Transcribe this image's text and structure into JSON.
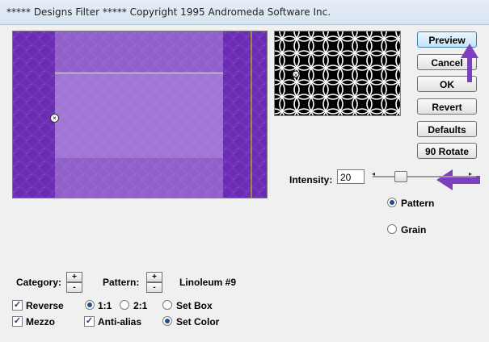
{
  "window": {
    "title": "***** Designs Filter *****  Copyright 1995 Andromeda Software Inc."
  },
  "buttons": {
    "preview": "Preview",
    "cancel": "Cancel",
    "ok": "OK",
    "revert": "Revert",
    "defaults": "Defaults",
    "rotate": "90 Rotate"
  },
  "intensity": {
    "label": "Intensity:",
    "value": "20",
    "slider_fraction": 0.2
  },
  "mode": {
    "pattern_label": "Pattern",
    "grain_label": "Grain",
    "selected": "pattern"
  },
  "category": {
    "label": "Category:",
    "plus": "+",
    "minus": "-"
  },
  "pattern_selector": {
    "label": "Pattern:",
    "plus": "+",
    "minus": "-",
    "current": "Linoleum #9"
  },
  "options": {
    "reverse_label": "Reverse",
    "reverse_checked": true,
    "mezzo_label": "Mezzo",
    "mezzo_checked": true,
    "scale_1_1": "1:1",
    "scale_2_1": "2:1",
    "scale_selected": "1:1",
    "antialias_label": "Anti-alias",
    "antialias_checked": true,
    "set_box_label": "Set Box",
    "set_color_label": "Set Color",
    "set_selected": "set-color"
  },
  "colors": {
    "preview_purple": "#6b2bb5",
    "annotation_arrow": "#7b3fbf",
    "primary_button_border": "#3c7fb1"
  }
}
